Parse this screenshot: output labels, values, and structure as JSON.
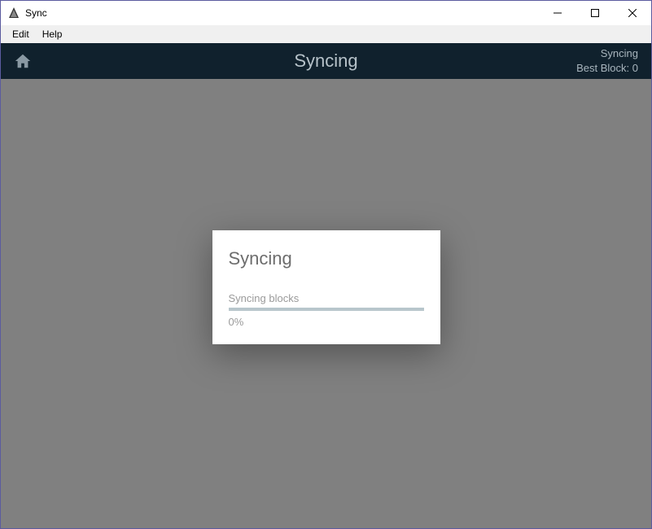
{
  "window": {
    "title": "Sync"
  },
  "menubar": {
    "edit": "Edit",
    "help": "Help"
  },
  "header": {
    "title": "Syncing",
    "status_line1": "Syncing",
    "status_line2_label": "Best Block:",
    "status_line2_value": "0"
  },
  "dialog": {
    "title": "Syncing",
    "subtitle": "Syncing blocks",
    "percent": "0%",
    "progress_value": 0
  }
}
